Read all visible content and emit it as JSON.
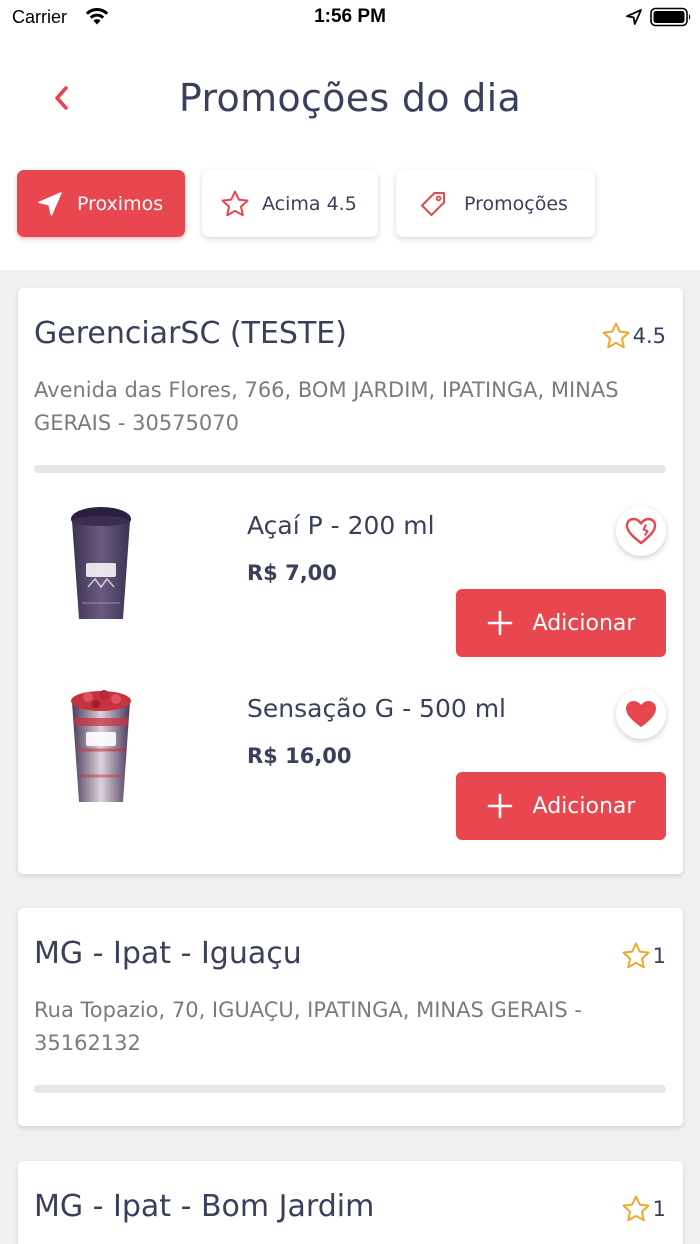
{
  "status_bar": {
    "carrier": "Carrier",
    "time": "1:56 PM"
  },
  "header": {
    "title": "Promoções do dia",
    "back_icon": "chevron-left-icon"
  },
  "filters": [
    {
      "label": "Proximos",
      "icon": "navigation-arrow-icon",
      "active": true
    },
    {
      "label": "Acima 4.5",
      "icon": "star-icon",
      "active": false
    },
    {
      "label": "Promoções",
      "icon": "price-tag-icon",
      "active": false
    }
  ],
  "stores": [
    {
      "name": "GerenciarSC (TESTE)",
      "rating": "4.5",
      "address": "Avenida das Flores, 766, BOM JARDIM, IPATINGA, MINAS GERAIS - 30575070",
      "products": [
        {
          "name": "Açaí P - 200 ml",
          "price": "R$ 7,00",
          "favorite": false,
          "add_label": "Adicionar"
        },
        {
          "name": "Sensação G - 500 ml",
          "price": "R$ 16,00",
          "favorite": true,
          "add_label": "Adicionar"
        }
      ]
    },
    {
      "name": "MG - Ipat - Iguaçu",
      "rating": "1",
      "address": "Rua Topazio, 70, IGUAÇU, IPATINGA, MINAS GERAIS - 35162132",
      "products": []
    },
    {
      "name": "MG - Ipat - Bom Jardim",
      "rating": "1",
      "address": "",
      "products": []
    }
  ],
  "colors": {
    "accent": "#e8474f",
    "title_text": "#3a3f5c",
    "muted_text": "#7b7b7b",
    "star": "#f0a830",
    "background": "#f0f0f2"
  }
}
